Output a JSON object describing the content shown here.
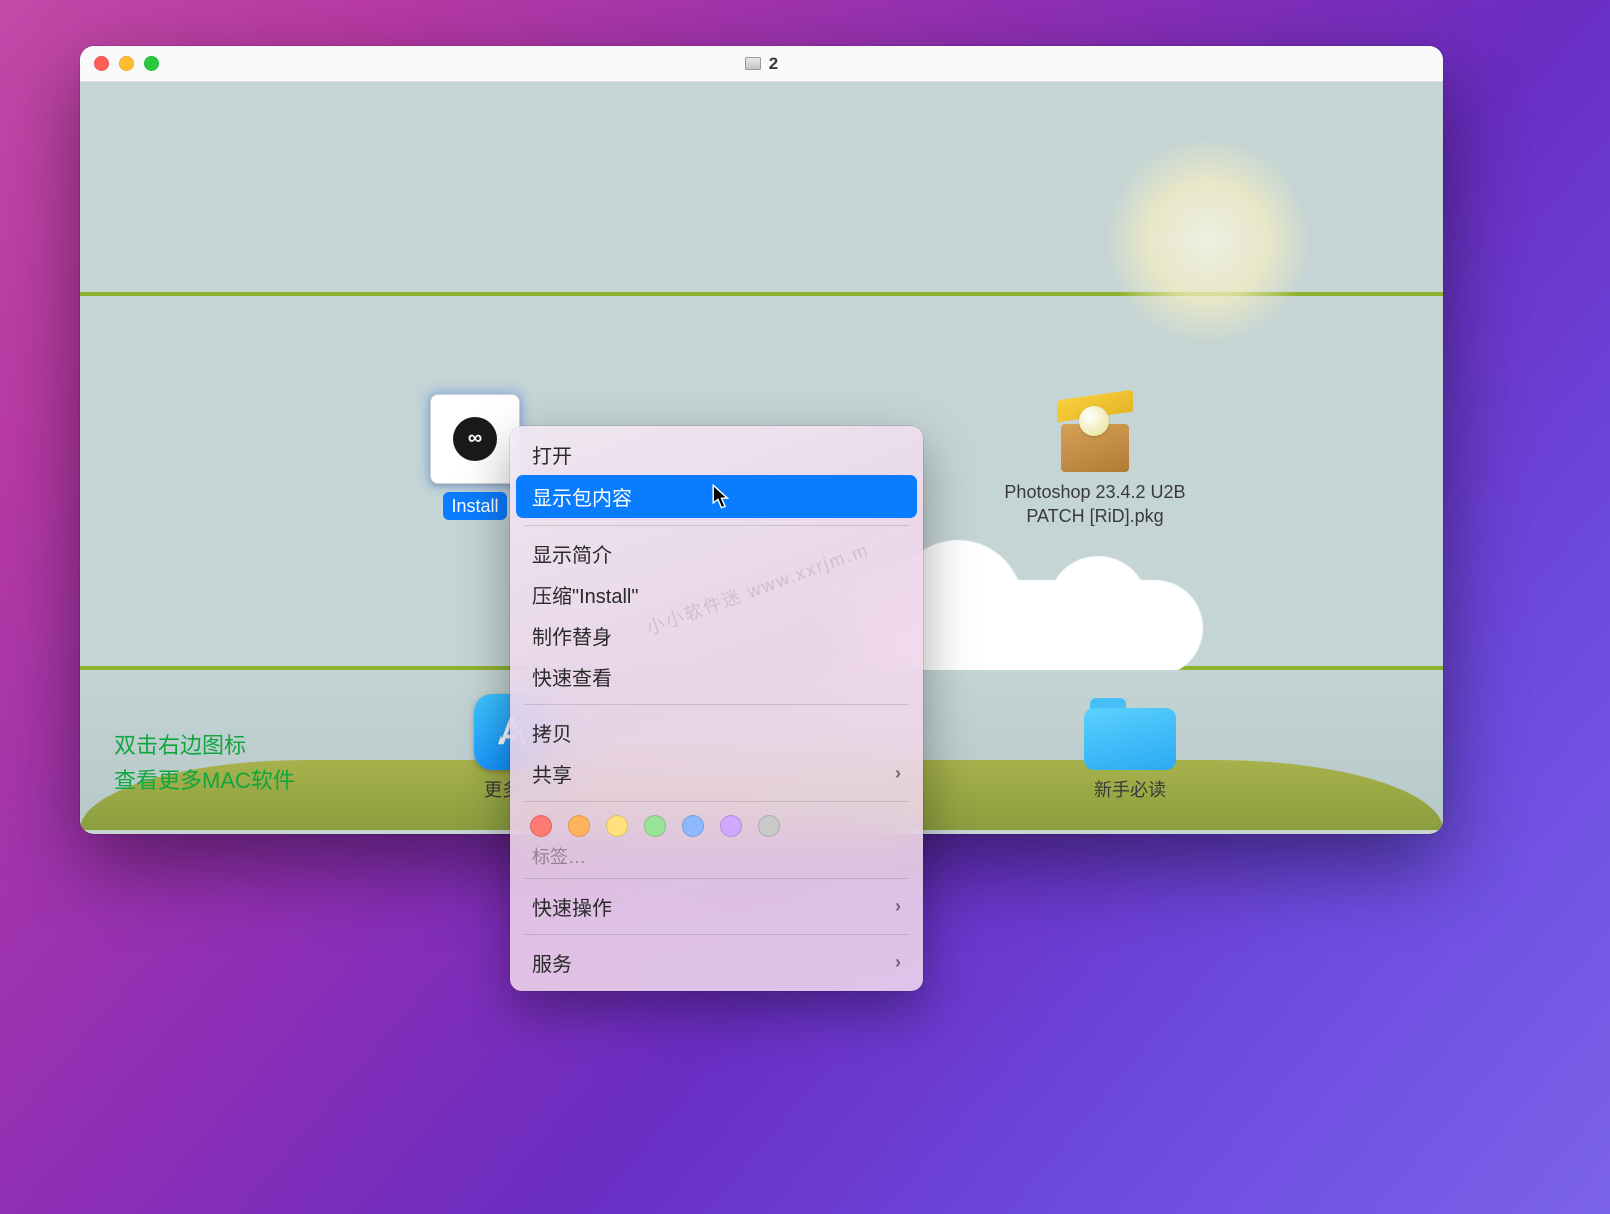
{
  "window": {
    "title": "2"
  },
  "files": {
    "install": {
      "label": "Install"
    },
    "patch": {
      "label_l1": "Photoshop 23.4.2 U2B",
      "label_l2": "PATCH [RiD].pkg"
    },
    "more": {
      "label": "更多 M"
    },
    "readme": {
      "label": "新手必读"
    }
  },
  "hint": {
    "line1": "双击右边图标",
    "line2": "查看更多MAC软件"
  },
  "menu": {
    "open": "打开",
    "show_contents": "显示包内容",
    "get_info": "显示简介",
    "compress": "压缩\"Install\"",
    "alias": "制作替身",
    "quicklook": "快速查看",
    "copy": "拷贝",
    "share": "共享",
    "tags_label": "标签…",
    "quick_actions": "快速操作",
    "services": "服务"
  },
  "watermark": "小小软件迷  www.xxrjm.m"
}
